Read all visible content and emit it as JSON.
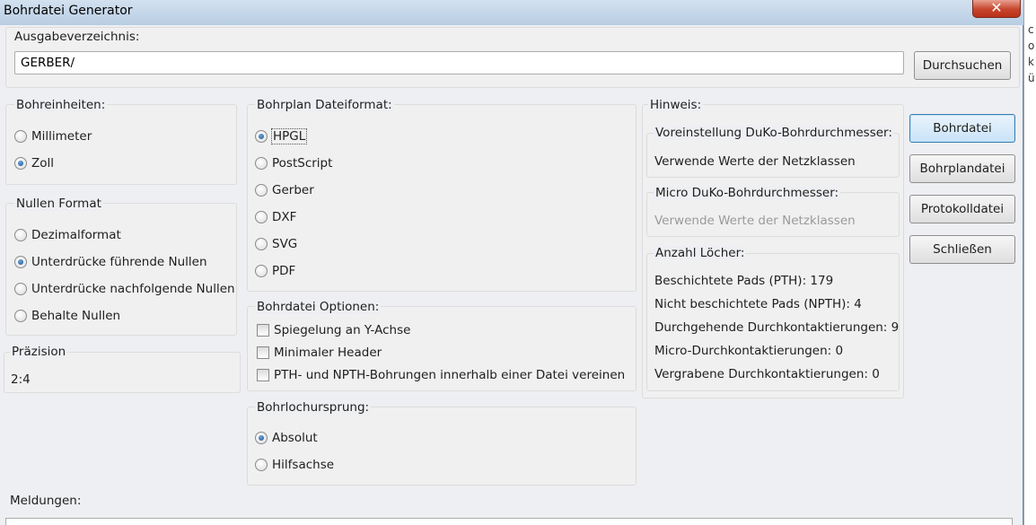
{
  "window": {
    "title": "Bohrdatei Generator",
    "close_label": "✕"
  },
  "output": {
    "label": "Ausgabeverzeichnis:",
    "path_value": "GERBER/",
    "browse_label": "Durchsuchen"
  },
  "drill_units": {
    "label": "Bohreinheiten:",
    "options": [
      "Millimeter",
      "Zoll"
    ],
    "selected": "Zoll"
  },
  "zero_format": {
    "label": "Nullen Format",
    "options": [
      "Dezimalformat",
      "Unterdrücke führende Nullen",
      "Unterdrücke nachfolgende Nullen",
      "Behalte Nullen"
    ],
    "selected": "Unterdrücke führende Nullen"
  },
  "precision": {
    "label": "Präzision",
    "value": "2:4"
  },
  "map_format": {
    "label": "Bohrplan Dateiformat:",
    "options": [
      "HPGL",
      "PostScript",
      "Gerber",
      "DXF",
      "SVG",
      "PDF"
    ],
    "selected": "HPGL"
  },
  "drill_options": {
    "label": "Bohrdatei Optionen:",
    "checks": [
      "Spiegelung an Y-Achse",
      "Minimaler Header",
      "PTH- und NPTH-Bohrungen innerhalb einer Datei vereinen"
    ]
  },
  "origin": {
    "label": "Bohrlochursprung:",
    "options": [
      "Absolut",
      "Hilfsachse"
    ],
    "selected": "Absolut"
  },
  "info": {
    "label": "Hinweis:",
    "default_via": {
      "label": "Voreinstellung DuKo-Bohrdurchmesser:",
      "value": "Verwende Werte der Netzklassen"
    },
    "micro_via": {
      "label": "Micro DuKo-Bohrdurchmesser:",
      "value": "Verwende Werte der Netzklassen"
    },
    "holes": {
      "label": "Anzahl Löcher:",
      "lines": [
        "Beschichtete Pads (PTH): 179",
        "Nicht beschichtete Pads (NPTH): 4",
        "Durchgehende Durchkontaktierungen: 9",
        "Micro-Durchkontaktierungen: 0",
        "Vergrabene Durchkontaktierungen: 0"
      ]
    }
  },
  "buttons": {
    "drill_file": "Bohrdatei",
    "map_file": "Bohrplandatei",
    "report_file": "Protokolldatei",
    "close": "Schließen"
  },
  "messages": {
    "label": "Meldungen:"
  },
  "background_window": {
    "side_letters": [
      "c",
      "o",
      "k",
      "ü"
    ]
  },
  "colors": {
    "accent": "#3c7fb1",
    "close_red": "#c7442c"
  }
}
